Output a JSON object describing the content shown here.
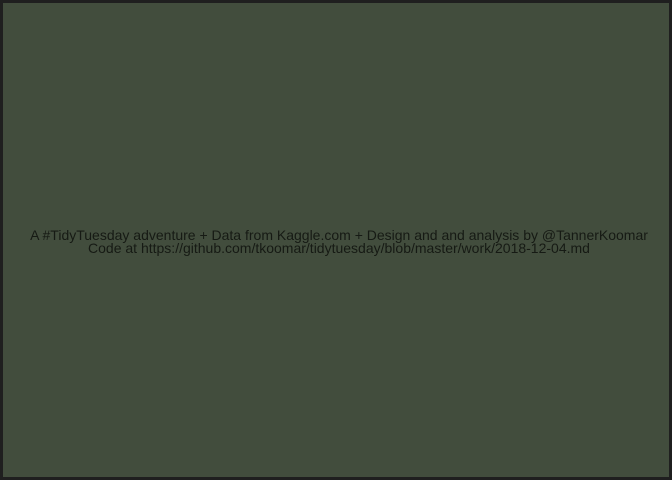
{
  "caption": {
    "line1": "A #TidyTuesday adventure + Data from Kaggle.com + Design and and analysis by @TannerKoomar",
    "line2": "Code at https://github.com/tkoomar/tidytuesday/blob/master/work/2018-12-04.md"
  },
  "colors": {
    "background": "#424d3d",
    "border": "#1f1f1f",
    "text": "#161a14"
  }
}
